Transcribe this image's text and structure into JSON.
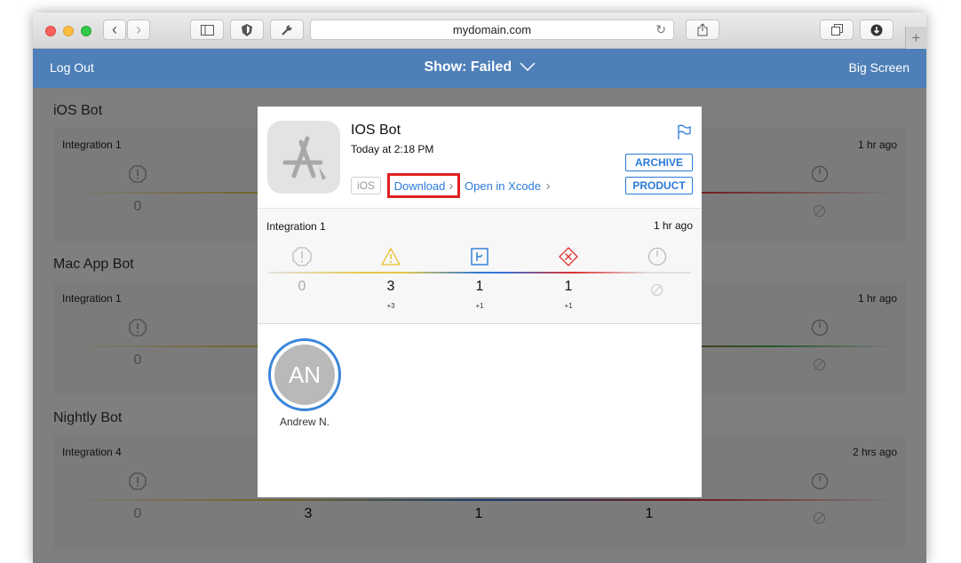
{
  "browser": {
    "url": "mydomain.com",
    "buttons": {
      "back": "‹",
      "forward": "›",
      "new_tab": "+"
    }
  },
  "header": {
    "left": "Log Out",
    "center": "Show: Failed",
    "right": "Big Screen"
  },
  "bots": [
    {
      "name": "iOS Bot",
      "integration": "Integration 1",
      "ago": "1 hr ago",
      "values": [
        "0",
        "",
        "",
        "",
        ""
      ]
    },
    {
      "name": "Mac App Bot",
      "integration": "Integration 1",
      "ago": "1 hr ago",
      "values": [
        "0",
        "",
        "",
        "",
        ""
      ]
    },
    {
      "name": "Nightly Bot",
      "integration": "Integration 4",
      "ago": "2 hrs ago",
      "values": [
        "0",
        "3",
        "1",
        "1",
        ""
      ]
    }
  ],
  "modal": {
    "title": "IOS Bot",
    "date": "Today at 2:18 PM",
    "platform": "iOS",
    "download": "Download",
    "open_in_xcode": "Open in Xcode",
    "archive": "ARCHIVE",
    "product": "PRODUCT",
    "integration": "Integration 1",
    "ago": "1 hr ago",
    "stats": [
      {
        "type": "errors",
        "value": "0",
        "delta": ""
      },
      {
        "type": "warnings",
        "value": "3",
        "delta": "+3"
      },
      {
        "type": "analyzer",
        "value": "1",
        "delta": "+1"
      },
      {
        "type": "test-failures",
        "value": "1",
        "delta": "+1"
      },
      {
        "type": "duration",
        "value": "",
        "delta": ""
      }
    ],
    "committer": {
      "initials": "AN",
      "name": "Andrew N."
    }
  },
  "colors": {
    "header": "#4e7fb8",
    "accent": "#2a7ad8",
    "highlight": "#e02020"
  }
}
